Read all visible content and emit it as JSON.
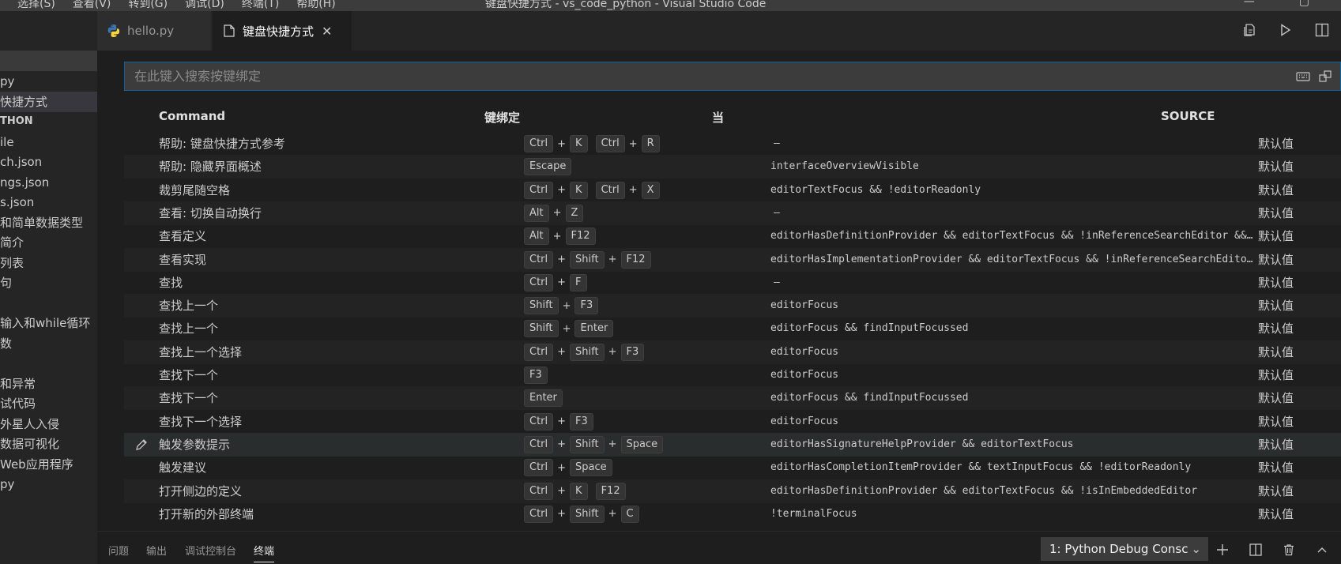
{
  "titlebar": {
    "menu": [
      "选择(S)",
      "查看(V)",
      "转到(G)",
      "调试(D)",
      "终端(T)",
      "帮助(H)"
    ],
    "window_title": "键盘快捷方式 - vs_code_python - Visual Studio Code"
  },
  "sidebar": {
    "items": [
      {
        "label": "py",
        "selected": false,
        "header": false
      },
      {
        "label": "快捷方式",
        "selected": true,
        "header": false
      },
      {
        "label": "THON",
        "selected": false,
        "header": true
      },
      {
        "label": "ile",
        "selected": false,
        "header": false
      },
      {
        "label": "ch.json",
        "selected": false,
        "header": false
      },
      {
        "label": "ngs.json",
        "selected": false,
        "header": false
      },
      {
        "label": "s.json",
        "selected": false,
        "header": false
      },
      {
        "label": "和简单数据类型",
        "selected": false,
        "header": false
      },
      {
        "label": "简介",
        "selected": false,
        "header": false
      },
      {
        "label": "列表",
        "selected": false,
        "header": false
      },
      {
        "label": "句",
        "selected": false,
        "header": false
      },
      {
        "label": "",
        "selected": false,
        "header": false
      },
      {
        "label": "输入和while循环",
        "selected": false,
        "header": false
      },
      {
        "label": "数",
        "selected": false,
        "header": false
      },
      {
        "label": "",
        "selected": false,
        "header": false
      },
      {
        "label": "和异常",
        "selected": false,
        "header": false
      },
      {
        "label": "试代码",
        "selected": false,
        "header": false
      },
      {
        "label": "外星人入侵",
        "selected": false,
        "header": false
      },
      {
        "label": "数据可视化",
        "selected": false,
        "header": false
      },
      {
        "label": "Web应用程序",
        "selected": false,
        "header": false
      },
      {
        "label": "py",
        "selected": false,
        "header": false
      }
    ]
  },
  "tabs": [
    {
      "label": "hello.py",
      "icon": "python-icon",
      "active": false
    },
    {
      "label": "键盘快捷方式",
      "icon": "file-icon",
      "active": true
    }
  ],
  "search": {
    "placeholder": "在此键入搜索按键绑定",
    "value": ""
  },
  "table": {
    "headers": {
      "command": "Command",
      "keybinding": "键绑定",
      "when": "当",
      "source": "SOURCE"
    },
    "rows": [
      {
        "command": "帮助: 键盘快捷方式参考",
        "keys": [
          [
            "Ctrl",
            "K"
          ],
          [
            "Ctrl",
            "R"
          ]
        ],
        "when": "—",
        "source": "默认值"
      },
      {
        "command": "帮助: 隐藏界面概述",
        "keys": [
          [
            "Escape"
          ]
        ],
        "when": "interfaceOverviewVisible",
        "source": "默认值"
      },
      {
        "command": "裁剪尾随空格",
        "keys": [
          [
            "Ctrl",
            "K"
          ],
          [
            "Ctrl",
            "X"
          ]
        ],
        "when": "editorTextFocus && !editorReadonly",
        "source": "默认值"
      },
      {
        "command": "查看: 切换自动换行",
        "keys": [
          [
            "Alt",
            "Z"
          ]
        ],
        "when": "—",
        "source": "默认值"
      },
      {
        "command": "查看定义",
        "keys": [
          [
            "Alt",
            "F12"
          ]
        ],
        "when": "editorHasDefinitionProvider && editorTextFocus && !inReferenceSearchEditor && !isInEmbeddedEditor",
        "source": "默认值"
      },
      {
        "command": "查看实现",
        "keys": [
          [
            "Ctrl",
            "Shift",
            "F12"
          ]
        ],
        "when": "editorHasImplementationProvider && editorTextFocus && !inReferenceSearchEditor && !isInEmbeddedEditor",
        "source": "默认值"
      },
      {
        "command": "查找",
        "keys": [
          [
            "Ctrl",
            "F"
          ]
        ],
        "when": "—",
        "source": "默认值"
      },
      {
        "command": "查找上一个",
        "keys": [
          [
            "Shift",
            "F3"
          ]
        ],
        "when": "editorFocus",
        "source": "默认值"
      },
      {
        "command": "查找上一个",
        "keys": [
          [
            "Shift",
            "Enter"
          ]
        ],
        "when": "editorFocus && findInputFocussed",
        "source": "默认值"
      },
      {
        "command": "查找上一个选择",
        "keys": [
          [
            "Ctrl",
            "Shift",
            "F3"
          ]
        ],
        "when": "editorFocus",
        "source": "默认值"
      },
      {
        "command": "查找下一个",
        "keys": [
          [
            "F3"
          ]
        ],
        "when": "editorFocus",
        "source": "默认值"
      },
      {
        "command": "查找下一个",
        "keys": [
          [
            "Enter"
          ]
        ],
        "when": "editorFocus && findInputFocussed",
        "source": "默认值"
      },
      {
        "command": "查找下一个选择",
        "keys": [
          [
            "Ctrl",
            "F3"
          ]
        ],
        "when": "editorFocus",
        "source": "默认值"
      },
      {
        "command": "触发参数提示",
        "keys": [
          [
            "Ctrl",
            "Shift",
            "Space"
          ]
        ],
        "when": "editorHasSignatureHelpProvider && editorTextFocus",
        "source": "默认值"
      },
      {
        "command": "触发建议",
        "keys": [
          [
            "Ctrl",
            "Space"
          ]
        ],
        "when": "editorHasCompletionItemProvider && textInputFocus && !editorReadonly",
        "source": "默认值"
      },
      {
        "command": "打开侧边的定义",
        "keys": [
          [
            "Ctrl",
            "K"
          ],
          [
            "F12"
          ]
        ],
        "when": "editorHasDefinitionProvider && editorTextFocus && !isInEmbeddedEditor",
        "source": "默认值"
      },
      {
        "command": "打开新的外部终端",
        "keys": [
          [
            "Ctrl",
            "Shift",
            "C"
          ]
        ],
        "when": "!terminalFocus",
        "source": "默认值"
      }
    ],
    "hovered_row": 13
  },
  "panel": {
    "tabs": [
      "问题",
      "输出",
      "调试控制台",
      "终端"
    ],
    "active_tab": "终端",
    "terminal_select": "1: Python Debug Consc"
  },
  "colors": {
    "background": "#1e1e1e",
    "sidebar": "#252526",
    "focus_border": "#0e639c"
  }
}
